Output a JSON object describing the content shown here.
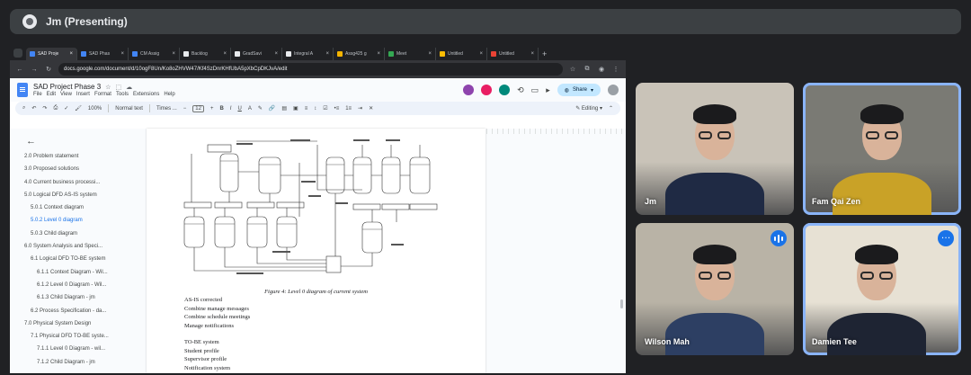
{
  "banner": {
    "presenter": "Jm (Presenting)"
  },
  "browser": {
    "tabs": [
      {
        "label": "SAD Proje",
        "color": "#4285f4",
        "active": true
      },
      {
        "label": "SAD Phas",
        "color": "#4285f4"
      },
      {
        "label": "CM Assig",
        "color": "#4285f4"
      },
      {
        "label": "Backlog",
        "color": "#e8eaed"
      },
      {
        "label": "GradSavi",
        "color": "#e8eaed"
      },
      {
        "label": "Integral A",
        "color": "#e8eaed"
      },
      {
        "label": "Assg425 g",
        "color": "#f4b400"
      },
      {
        "label": "Meet",
        "color": "#34a853"
      },
      {
        "label": "Untitled",
        "color": "#fbbc04"
      },
      {
        "label": "Untitled",
        "color": "#ea4335"
      }
    ],
    "url": "docs.google.com/document/d/10ogF8Un/Ko8oZHVW47/Kf4SzDnrKHfUbA5pXbCpDKJvA/edit"
  },
  "doc": {
    "title": "SAD Project Phase 3",
    "menus": [
      "File",
      "Edit",
      "View",
      "Insert",
      "Format",
      "Tools",
      "Extensions",
      "Help"
    ],
    "share_label": "Share",
    "toolbar": {
      "zoom": "100%",
      "style": "Normal text",
      "font": "Times ...",
      "font_size": "12",
      "mode": "Editing"
    },
    "outline": [
      {
        "text": "2.0 Problem statement",
        "level": 0
      },
      {
        "text": "3.0 Proposed solutions",
        "level": 0
      },
      {
        "text": "4.0 Current business processi...",
        "level": 0
      },
      {
        "text": "5.0 Logical DFD AS-IS system",
        "level": 0
      },
      {
        "text": "5.0.1 Context diagram",
        "level": 1
      },
      {
        "text": "5.0.2 Level 0 diagram",
        "level": 1,
        "active": true
      },
      {
        "text": "5.0.3 Child diagram",
        "level": 1
      },
      {
        "text": "6.0 System Analysis and Speci...",
        "level": 0
      },
      {
        "text": "6.1 Logical DFD TO-BE system",
        "level": 1
      },
      {
        "text": "6.1.1 Context Diagram - Wil...",
        "level": 2
      },
      {
        "text": "6.1.2 Level 0 Diagram - Wil...",
        "level": 2
      },
      {
        "text": "6.1.3 Child Diagram - jm",
        "level": 2
      },
      {
        "text": "6.2 Process Specification - da...",
        "level": 1
      },
      {
        "text": "7.0 Physical System Design",
        "level": 0
      },
      {
        "text": "7.1 Physical DFD TO-BE syste...",
        "level": 1
      },
      {
        "text": "7.1.1 Level 0 Diagram - wil...",
        "level": 2
      },
      {
        "text": "7.1.2 Child Diagram - jm",
        "level": 2
      }
    ],
    "figure_caption": "Figure 4: Level 0 diagram of current system",
    "body_lines": [
      "AS-IS corrected",
      "Combine manage messages",
      "Combine schedule meetings",
      "Manage notifications",
      "",
      "TO-BE system",
      "Student profile",
      "Supervisor profile",
      "Notification system"
    ]
  },
  "participants": [
    {
      "name": "Jm",
      "bg": "#c9c3b8",
      "shirt": "#1f2a44"
    },
    {
      "name": "Fam Qai Zen",
      "bg": "#7a7a74",
      "shirt": "#c9a227",
      "active": true
    },
    {
      "name": "Wilson Mah",
      "bg": "#b9b3a6",
      "shirt": "#2d3f63",
      "speaking": true
    },
    {
      "name": "Damien Tee",
      "bg": "#e7e1d4",
      "shirt": "#1e2433",
      "active": true,
      "more": true
    }
  ]
}
